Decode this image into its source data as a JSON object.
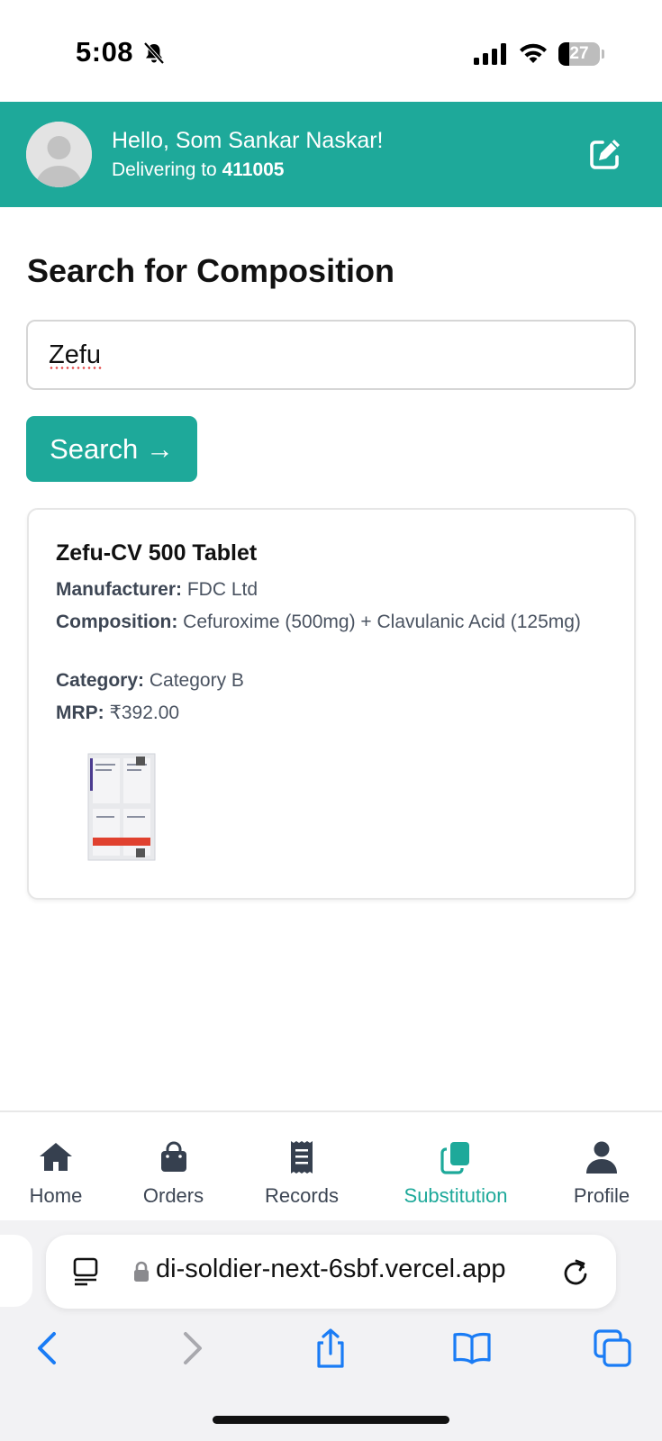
{
  "status_bar": {
    "time": "5:08",
    "battery_level": "27",
    "icons": [
      "bell-slash-icon",
      "cellular-signal-icon",
      "wifi-icon",
      "battery-icon"
    ]
  },
  "header": {
    "greeting": "Hello, Som Sankar Naskar!",
    "delivering_prefix": "Delivering to ",
    "pincode": "411005",
    "edit_icon": "edit-icon",
    "avatar_icon": "user-avatar-icon"
  },
  "main": {
    "title": "Search for Composition",
    "search_value": "Zefu",
    "search_button": "Search →"
  },
  "result": {
    "name": "Zefu-CV 500 Tablet",
    "manufacturer_label": "Manufacturer",
    "manufacturer": "FDC Ltd",
    "composition_label": "Composition",
    "composition": "Cefuroxime (500mg) + Clavulanic Acid (125mg)",
    "category_label": "Category",
    "category": "Category B",
    "mrp_label": "MRP",
    "mrp": "₹392.00"
  },
  "nav": {
    "items": [
      {
        "label": "Home",
        "icon": "home-icon"
      },
      {
        "label": "Orders",
        "icon": "shopping-bag-icon"
      },
      {
        "label": "Records",
        "icon": "receipt-icon"
      },
      {
        "label": "Substitution",
        "icon": "copy-icon",
        "active": true
      },
      {
        "label": "Profile",
        "icon": "user-icon"
      }
    ]
  },
  "browser": {
    "url": "di-soldier-next-6sbf.vercel.app"
  },
  "colors": {
    "accent": "#1ea99a",
    "text_muted": "#4a5361",
    "safari_blue": "#1a7cf5"
  }
}
